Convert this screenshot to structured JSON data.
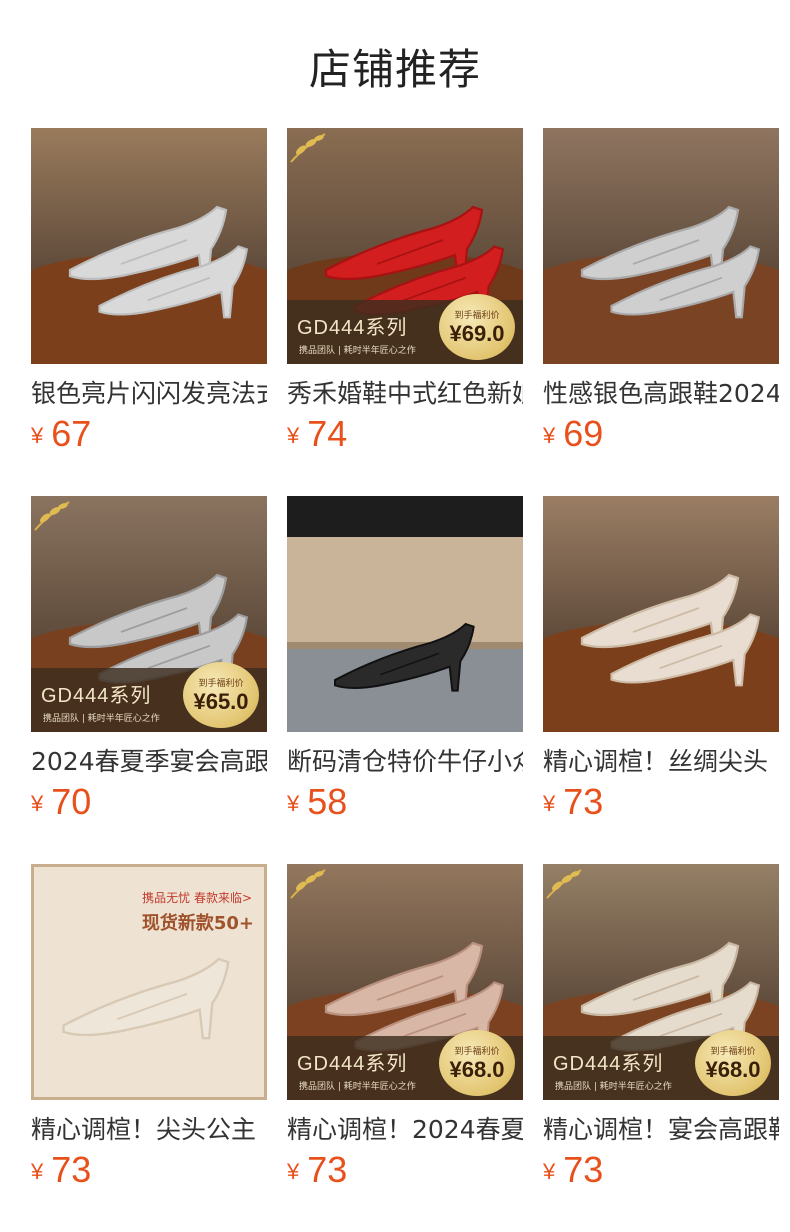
{
  "section_title": "店铺推荐",
  "currency": "¥",
  "products": [
    {
      "name": "银色亮片闪闪发亮法式",
      "price": "67",
      "scene": "silver-glitter",
      "overlay": null
    },
    {
      "name": "秀禾婚鞋中式红色新娘",
      "price": "74",
      "scene": "red-pearl",
      "overlay": {
        "series": "GD444系列",
        "sub": "携品团队 | 耗时半年匠心之作",
        "badge_label": "到手福利价",
        "badge_price": "¥69.0"
      }
    },
    {
      "name": "性感银色高跟鞋2024",
      "price": "69",
      "scene": "silver-pearl",
      "overlay": null
    },
    {
      "name": "2024春夏季宴会高跟",
      "price": "70",
      "scene": "silver-metallic",
      "overlay": {
        "series": "GD444系列",
        "sub": "携品团队 | 耗时半年匠心之作",
        "badge_label": "到手福利价",
        "badge_price": "¥65.0"
      }
    },
    {
      "name": "断码清仓特价牛仔小众",
      "price": "58",
      "scene": "black-model",
      "overlay": null
    },
    {
      "name": "精心调楦！丝绸尖头",
      "price": "73",
      "scene": "cream-pearl",
      "overlay": null
    },
    {
      "name": "精心调楦！尖头公主",
      "price": "73",
      "scene": "bow-poster",
      "overlay": null,
      "poster": {
        "tag": "携品无忧 春款来临>",
        "headline": "现货新款50+"
      }
    },
    {
      "name": "精心调楦！2024春夏",
      "price": "73",
      "scene": "nude-buckle",
      "overlay": {
        "series": "GD444系列",
        "sub": "携品团队 | 耗时半年匠心之作",
        "badge_label": "到手福利价",
        "badge_price": "¥68.0"
      }
    },
    {
      "name": "精心调楦！宴会高跟鞋",
      "price": "73",
      "scene": "cream-flower",
      "overlay": {
        "series": "GD444系列",
        "sub": "携品团队 | 耗时半年匠心之作",
        "badge_label": "到手福利价",
        "badge_price": "¥68.0"
      }
    }
  ]
}
